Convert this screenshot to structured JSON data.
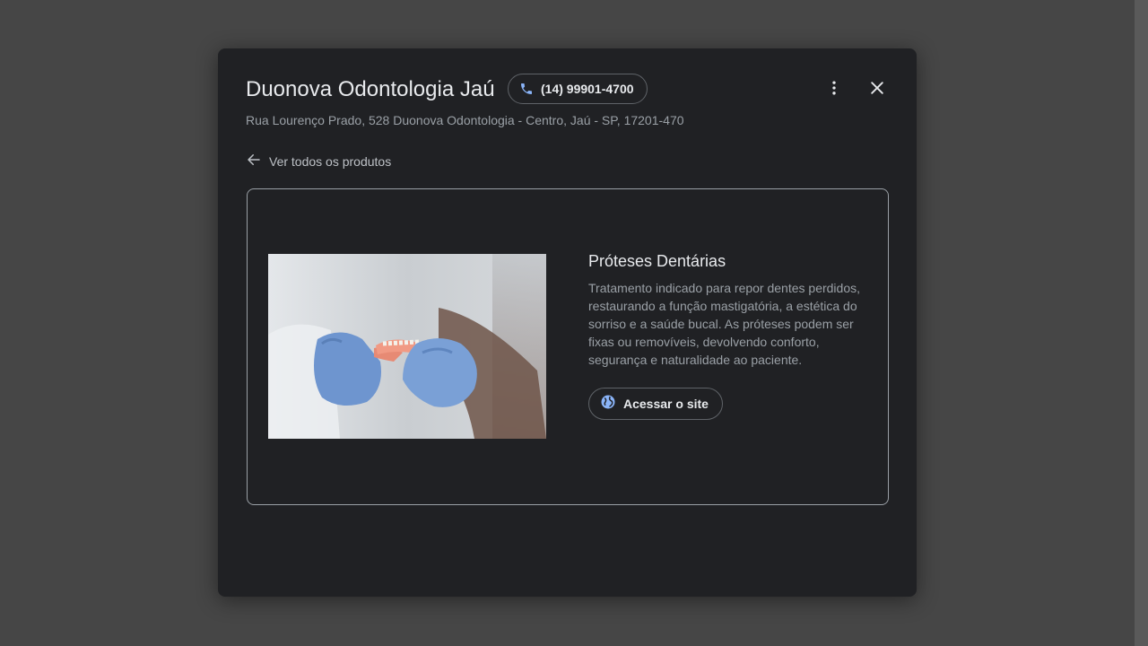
{
  "business": {
    "name": "Duonova Odontologia Jaú",
    "phone": "(14) 99901-4700",
    "address": "Rua Lourenço Prado, 528 Duonova Odontologia - Centro, Jaú - SP, 17201-470"
  },
  "navigation": {
    "back_label": "Ver todos os produtos"
  },
  "product": {
    "title": "Próteses Dentárias",
    "description": "Tratamento indicado para repor dentes perdidos, restaurando a função mastigatória, a estética do sorriso e a saúde bucal. As próteses podem ser fixas ou removíveis, devolvendo conforto, segurança e naturalidade ao paciente.",
    "site_button_label": "Acessar o site"
  },
  "icons": {
    "phone": "phone-icon",
    "more": "more-vert-icon",
    "close": "close-icon",
    "back": "arrow-back-icon",
    "globe": "globe-icon"
  },
  "colors": {
    "accent_blue": "#8ab4f8",
    "modal_bg": "#202124",
    "backdrop": "#464646"
  }
}
